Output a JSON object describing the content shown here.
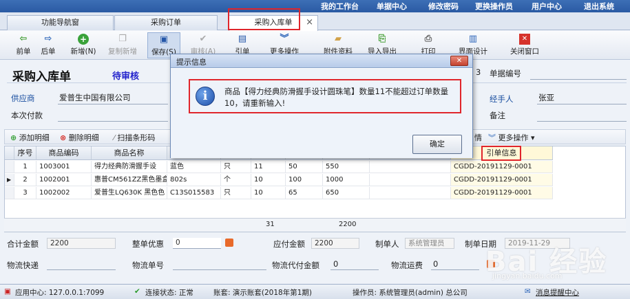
{
  "topnav": [
    "我的工作台",
    "单据中心",
    "修改密码",
    "更换操作员",
    "用户中心",
    "退出系统"
  ],
  "tabs": [
    {
      "label": "功能导航窗"
    },
    {
      "label": "采购订单"
    },
    {
      "label": "采购入库单",
      "close": "×"
    }
  ],
  "toolbar": [
    {
      "label": "前单",
      "icon": "arrow-left-icon"
    },
    {
      "label": "后单",
      "icon": "arrow-right-icon"
    },
    {
      "label": "新增(N)",
      "icon": "plus-circle-icon"
    },
    {
      "label": "复制新增",
      "icon": "copy-icon"
    },
    {
      "label": "保存(S)",
      "icon": "save-icon"
    },
    {
      "label": "审核(A)",
      "icon": "check-icon"
    },
    {
      "label": "引单",
      "icon": "doc-icon"
    },
    {
      "label": "更多操作",
      "icon": "double-chevron-icon"
    },
    {
      "label": "附件资料",
      "icon": "folder-icon"
    },
    {
      "label": "导入导出",
      "icon": "import-icon"
    },
    {
      "label": "打印",
      "icon": "printer-icon"
    },
    {
      "label": "界面设计",
      "icon": "layout-icon"
    },
    {
      "label": "关闭窗口",
      "icon": "close-icon"
    }
  ],
  "form": {
    "title": "采购入库单",
    "status": "待审核",
    "supplier_label": "供应商",
    "supplier_value": "爱普生中国有限公司",
    "payment_label": "本次付款",
    "doc_no_label": "单据编号",
    "doc_no_fragment": "3",
    "handler_label": "经手人",
    "handler_value": "张亚",
    "remark_label": "备注"
  },
  "grid_toolbar": {
    "add": "添加明细",
    "delete": "删除明细",
    "scan": "扫描条形码",
    "more": "更多操作",
    "fragment": "情"
  },
  "grid": {
    "headers": [
      "序号",
      "商品编码",
      "商品名称",
      "",
      "",
      "",
      "",
      "",
      "",
      "引单信息"
    ],
    "rows": [
      [
        "1",
        "1003001",
        "得力经典防滑握手设",
        "蓝色",
        "只",
        "11",
        "50",
        "550",
        "CGDD-20191129-0001"
      ],
      [
        "2",
        "1002001",
        "惠普CM561ZZ黑色墨盒",
        "802s",
        "个",
        "10",
        "100",
        "1000",
        "CGDD-20191129-0001"
      ],
      [
        "3",
        "1002002",
        "爱普生LQ630K 黑色色",
        "C13S015583",
        "只",
        "10",
        "65",
        "650",
        "CGDD-20191129-0001"
      ]
    ],
    "sum_qty": "31",
    "sum_amount": "2200"
  },
  "bottom": {
    "total_label": "合计金额",
    "total_value": "2200",
    "discount_label": "整单优惠",
    "discount_value": "0",
    "payable_label": "应付金额",
    "payable_value": "2200",
    "maker_label": "制单人",
    "maker_value": "系统管理员",
    "date_label": "制单日期",
    "date_value": "2019-11-29",
    "logistics_label": "物流快递",
    "logistics_no_label": "物流单号",
    "cod_label": "物流代付金额",
    "cod_value": "0",
    "freight_label": "物流运费",
    "freight_value": "0"
  },
  "statusbar": {
    "app": "应用中心: 127.0.0.1:7099",
    "conn": "连接状态: 正常",
    "account": "账套: 演示账套(2018年第1期)",
    "operator": "操作员: 系统管理员(admin) 总公司",
    "msg": "消息提醒中心"
  },
  "dialog": {
    "title": "提示信息",
    "close": "✕",
    "message": "商品【得力经典防滑握手设计圆珠笔】数量11不能超过订单数量10，请重新输入!",
    "ok": "确定"
  },
  "watermark": {
    "text": "Bai 经验",
    "sub": "jingyan.baidu.com"
  }
}
